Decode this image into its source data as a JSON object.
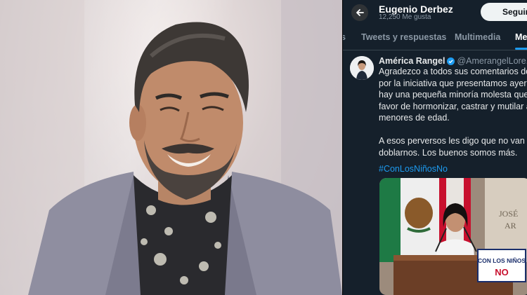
{
  "photo": {
    "description_icon": "person-photo"
  },
  "twitter": {
    "profile_name": "Eugenio Derbez",
    "profile_likes": "12,250 Me gusta",
    "follow_label": "Seguir",
    "tabs": [
      {
        "label": "s"
      },
      {
        "label": "Tweets y respuestas"
      },
      {
        "label": "Multimedia"
      },
      {
        "label": "Me"
      }
    ],
    "tweet": {
      "author_name": "América Rangel",
      "author_handle": "@AmerangelLore... ·",
      "lines": [
        "Agradezco a todos sus comentarios de a",
        "por la iniciativa que presentamos ayer, a",
        "hay una pequeña minoría molesta que e",
        "favor de hormonizar, castrar y mutilar a",
        "menores de edad.",
        "",
        "A esos perversos les digo que no van a",
        "doblarnos. Los buenos somos más."
      ],
      "hashtag": "#ConLosNiñosNo",
      "media": {
        "sign_line1": "CON LOS NIÑOS",
        "sign_line2": "NO",
        "wall_text": [
          "JOSÉ",
          "AR"
        ]
      }
    },
    "colors": {
      "background": "#15202b",
      "accent": "#1d9bf0",
      "muted": "#8b98a5"
    }
  }
}
